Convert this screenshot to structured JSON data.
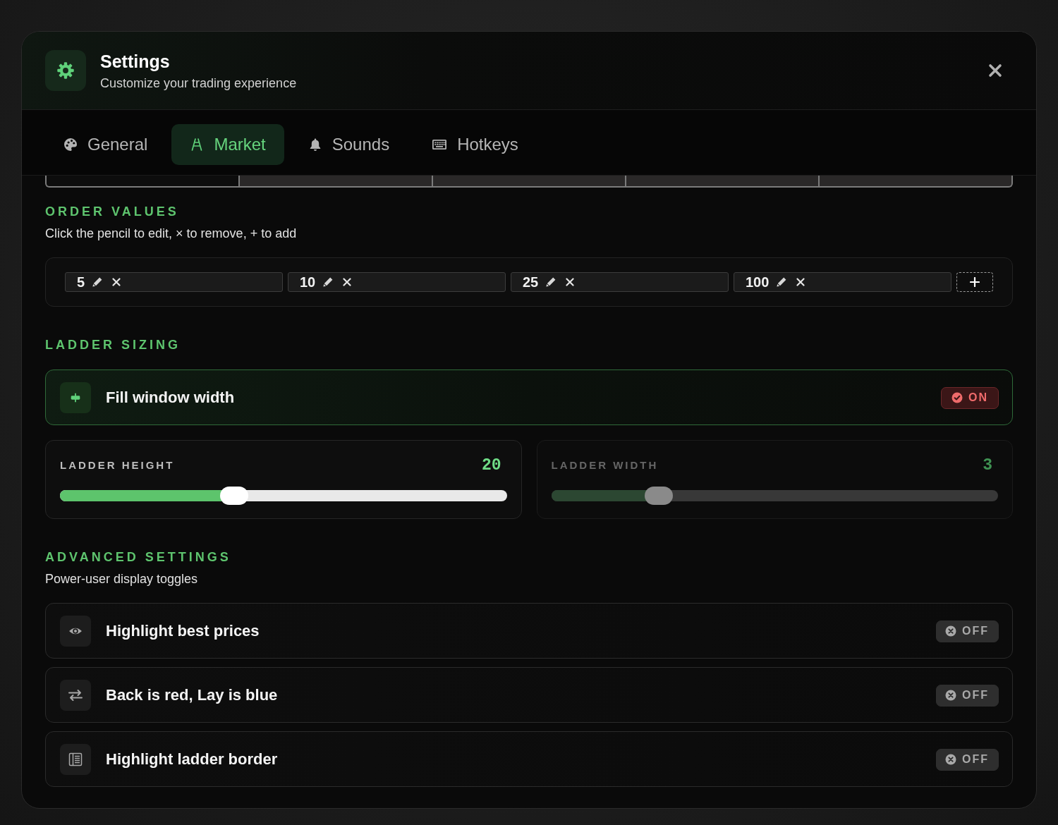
{
  "dialog": {
    "title": "Settings",
    "subtitle": "Customize your trading experience"
  },
  "tabs": [
    {
      "label": "General",
      "selected": false
    },
    {
      "label": "Market",
      "selected": true
    },
    {
      "label": "Sounds",
      "selected": false
    },
    {
      "label": "Hotkeys",
      "selected": false
    }
  ],
  "order_values": {
    "heading": "ORDER VALUES",
    "description": "Click the pencil to edit, × to remove, + to add",
    "values": [
      "5",
      "10",
      "25",
      "100"
    ]
  },
  "ladder_sizing": {
    "heading": "LADDER SIZING",
    "toggle": {
      "label": "Fill window width",
      "on": true,
      "status": "ON"
    },
    "sliders": [
      {
        "label": "LADDER HEIGHT",
        "value": "20",
        "level": 0.39,
        "disabled": false
      },
      {
        "label": "LADDER WIDTH",
        "value": "3",
        "level": 0.24,
        "disabled": true
      }
    ]
  },
  "advanced_settings": {
    "heading": "ADVANCED SETTINGS",
    "description": "Power-user display toggles",
    "toggles": [
      {
        "label": "Highlight best prices",
        "on": false,
        "status": "OFF"
      },
      {
        "label": "Back is red, Lay is blue",
        "on": false,
        "status": "OFF"
      },
      {
        "label": "Highlight ladder border",
        "on": false,
        "status": "OFF"
      }
    ]
  }
}
